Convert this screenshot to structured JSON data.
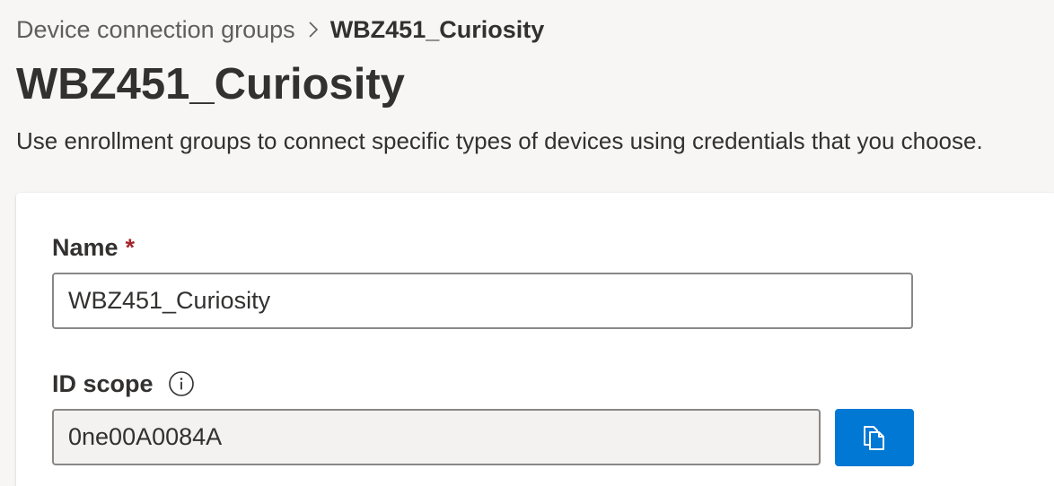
{
  "breadcrumb": {
    "parent": "Device connection groups",
    "current": "WBZ451_Curiosity"
  },
  "page": {
    "title": "WBZ451_Curiosity",
    "description": "Use enrollment groups to connect specific types of devices using credentials that you choose."
  },
  "form": {
    "name": {
      "label": "Name",
      "required_mark": "*",
      "value": "WBZ451_Curiosity"
    },
    "id_scope": {
      "label": "ID scope",
      "info_icon": "info-icon",
      "value": "0ne00A0084A",
      "copy_icon": "copy-icon"
    }
  },
  "colors": {
    "accent": "#0078d4",
    "required": "#a4262c",
    "background": "#f7f6f4",
    "readonly_field": "#f3f2f1"
  }
}
